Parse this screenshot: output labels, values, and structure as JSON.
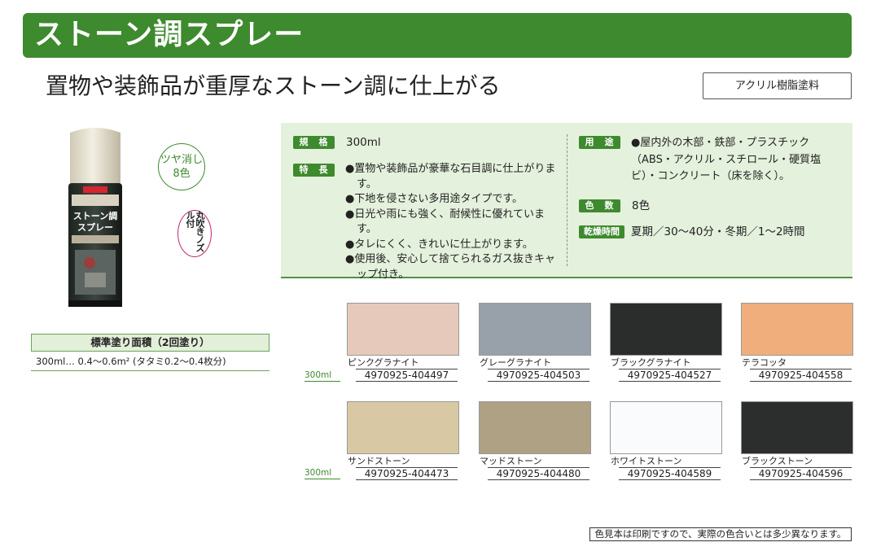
{
  "header": {
    "title": "ストーン調スプレー",
    "tagline": "置物や装飾品が重厚なストーン調に仕上がる",
    "category_badge": "アクリル樹脂塗料"
  },
  "product": {
    "finish_badge_line1": "ツヤ消し",
    "finish_badge_line2": "8色",
    "nozzle_badge": "丸吹きノズル付",
    "can_label_line1": "ストーン調",
    "can_label_line2": "スプレー"
  },
  "coverage": {
    "heading": "標準塗り面積（2回塗り）",
    "value": "300ml… 0.4～0.6m² (タタミ0.2～0.4枚分)"
  },
  "specs": {
    "spec_label": "規　格",
    "spec_value": "300ml",
    "features_label": "特　長",
    "features": [
      "置物や装飾品が豪華な石目調に仕上がります。",
      "下地を侵さない多用途タイプです。",
      "日光や雨にも強く、耐候性に優れています。",
      "タレにくく、きれいに仕上がります。",
      "使用後、安心して捨てられるガス抜きキャップ付き。"
    ],
    "use_label": "用　途",
    "use_value": "●屋内外の木部・鉄部・プラスチック（ABS・アクリル・スチロール・硬質塩ビ）・コンクリート（床を除く）。",
    "colors_label": "色　数",
    "colors_value": "8色",
    "dry_label": "乾燥時間",
    "dry_value": "夏期／30～40分・冬期／1～2時間"
  },
  "swatches": {
    "size_label": "300ml",
    "row1": [
      {
        "name": "ピンクグラナイト",
        "code": "4970925-404497",
        "color": "#e7c9bb"
      },
      {
        "name": "グレーグラナイト",
        "code": "4970925-404503",
        "color": "#98a1a9"
      },
      {
        "name": "ブラックグラナイト",
        "code": "4970925-404527",
        "color": "#2a2d2b"
      },
      {
        "name": "テラコッタ",
        "code": "4970925-404558",
        "color": "#f0ae7c"
      }
    ],
    "row2": [
      {
        "name": "サンドストーン",
        "code": "4970925-404473",
        "color": "#d8c8a3"
      },
      {
        "name": "マッドストーン",
        "code": "4970925-404480",
        "color": "#afa183"
      },
      {
        "name": "ホワイトストーン",
        "code": "4970925-404589",
        "color": "#fafbfc"
      },
      {
        "name": "ブラックストーン",
        "code": "4970925-404596",
        "color": "#2b2e2d"
      }
    ]
  },
  "footnote": "色見本は印刷ですので、実際の色合いとは多少異なります。",
  "colors": {
    "brand_green": "#3e8a2e",
    "panel_green": "#e4f1dc",
    "nozzle_pink": "#c6226b"
  }
}
